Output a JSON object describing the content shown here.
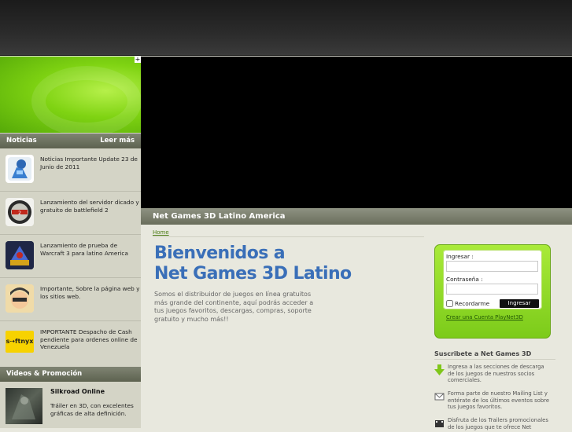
{
  "sidebar": {
    "plus": "+",
    "news_header": "Noticias",
    "news_more": "Leer más",
    "news": [
      {
        "text": "Noticias Importante Update 23 de Junio de 2011",
        "icon": "robot-icon"
      },
      {
        "text": "Lanzamiento del servidor dicado y gratuito de battlefield 2",
        "icon": "battlefield-icon"
      },
      {
        "text": "Lanzamiento de prueba de Warcraft 3 para latino America",
        "icon": "warcraft-icon"
      },
      {
        "text": "Importante, Sobre la página web y los sitios web.",
        "icon": "character-icon"
      },
      {
        "text": "IMPORTANTE Despacho de Cash pendiente para ordenes online de Venezuela",
        "icon": "softnyx-icon",
        "label": "s⇢ftnyx"
      }
    ],
    "videos_header": "Videos & Promoción",
    "video": {
      "title": "Silkroad Online",
      "desc": "Tráiler en 3D, con excelentes gráficas de alta definición."
    }
  },
  "main": {
    "title": "Net Games 3D Latino America",
    "breadcrumb": "Home",
    "welcome_line1": "Bienvenidos a",
    "welcome_line2": "Net Games 3D Latino",
    "intro": "Somos el distribuidor de juegos en línea gratuitos más grande del continente, aquí podrás acceder a tus juegos favoritos, descargas, compras, soporte gratuito y mucho más!!"
  },
  "login": {
    "user_label": "Ingresar :",
    "pass_label": "Contraseña :",
    "remember": "Recordarme",
    "submit": "Ingresar",
    "create": "Crear una Cuenta PlayNet3D"
  },
  "subscribe": {
    "title": "Suscribete a Net Games 3D",
    "items": [
      {
        "text": "Ingresa a las secciones de descarga de los juegos de nuestros socios comerciales.",
        "icon": "download-arrow-icon"
      },
      {
        "text": "Forma parte de nuestro Mailing List y entérate de los últimos eventos sobre tus juegos favoritos.",
        "icon": "mail-icon"
      },
      {
        "text": "Disfruta de los Trailers promocionales de los juegos que te ofrece Net",
        "icon": "film-icon"
      }
    ]
  },
  "colors": {
    "accent_green": "#7fd312",
    "title_blue": "#3a6fb8",
    "header_gray": "#6a6e5c"
  }
}
